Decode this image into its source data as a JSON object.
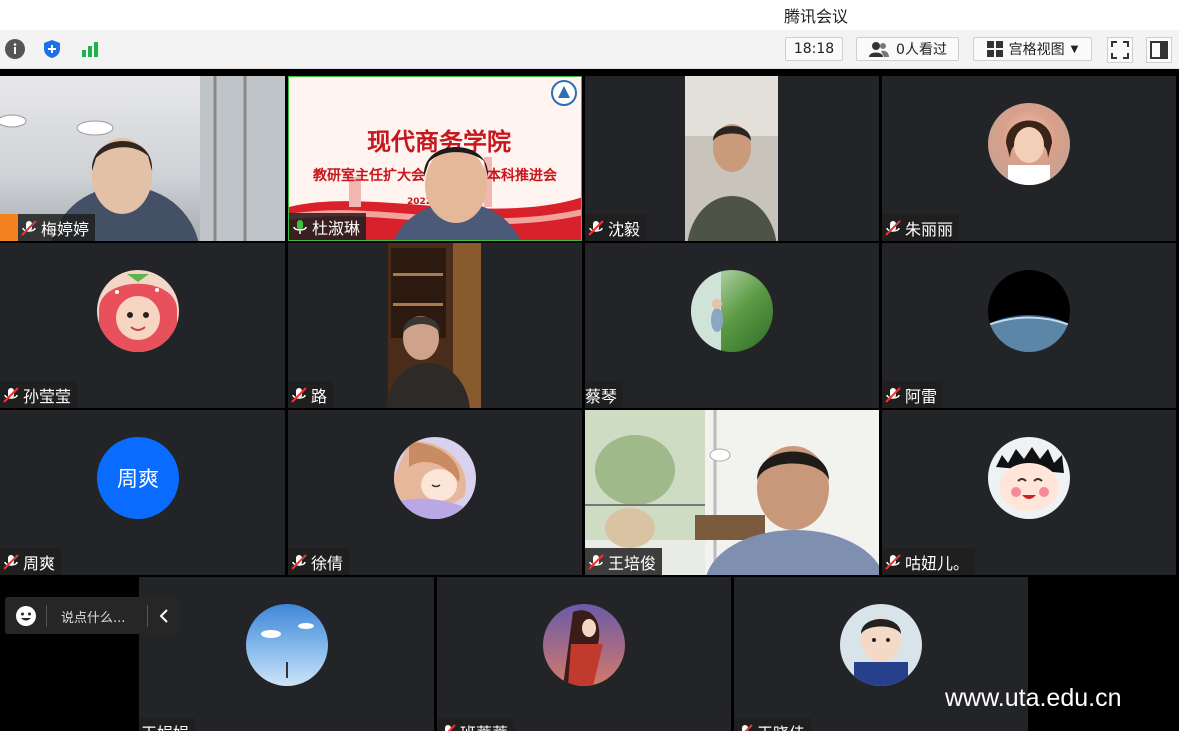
{
  "window": {
    "title": "腾讯会议"
  },
  "toolbar": {
    "time": "18:18",
    "viewers": "0人看过",
    "view_mode": "宫格视图"
  },
  "slide": {
    "title": "现代商务学院",
    "subtitle": "教研室主任扩大会",
    "subtitle2": "本科推进会",
    "year": "2022年"
  },
  "participants": [
    {
      "name": "梅婷婷"
    },
    {
      "name": "杜淑琳"
    },
    {
      "name": "沈毅"
    },
    {
      "name": "朱丽丽"
    },
    {
      "name": "孙莹莹"
    },
    {
      "name": "路"
    },
    {
      "name": "蔡琴"
    },
    {
      "name": "阿雷"
    },
    {
      "name": "周爽",
      "avatar_text": "周爽"
    },
    {
      "name": "徐倩"
    },
    {
      "name": "王培俊"
    },
    {
      "name": "咕妞儿。"
    },
    {
      "name": "王娟娟"
    },
    {
      "name": "班蒂蒂"
    },
    {
      "name": "王晓佳"
    }
  ],
  "chat": {
    "placeholder": "说点什么..."
  },
  "watermark": "www.uta.edu.cn",
  "colors": {
    "accent_blue": "#0a6cff",
    "mic_active": "#3ec03e",
    "tile_bg": "#232427"
  }
}
